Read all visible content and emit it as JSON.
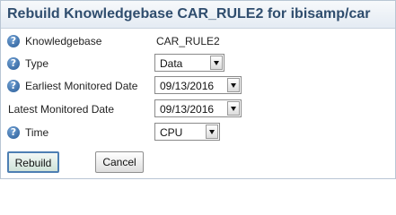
{
  "dialog": {
    "title": "Rebuild Knowledgebase CAR_RULE2 for ibisamp/car",
    "fields": {
      "knowledgebase": {
        "label": "Knowledgebase",
        "value": "CAR_RULE2"
      },
      "type": {
        "label": "Type",
        "value": "Data"
      },
      "earliest": {
        "label": "Earliest Monitored Date",
        "value": "09/13/2016"
      },
      "latest": {
        "label": "Latest Monitored Date",
        "value": "09/13/2016"
      },
      "time": {
        "label": "Time",
        "value": "CPU"
      }
    },
    "help_icon_glyph": "?",
    "buttons": {
      "rebuild": "Rebuild",
      "cancel": "Cancel"
    }
  },
  "colors": {
    "title_text": "#2f4d6e",
    "help_icon": "#2a5d98",
    "rebuild_border": "#4d7fb3"
  }
}
